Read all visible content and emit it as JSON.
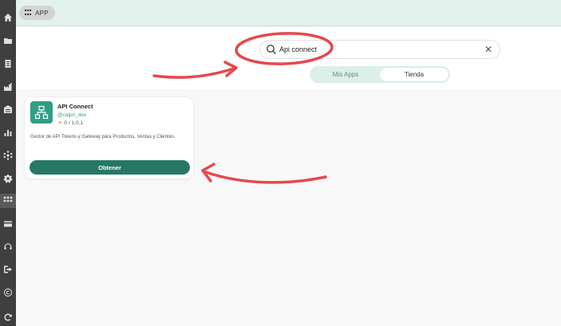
{
  "topbar": {
    "app_label": "APP"
  },
  "sidebar": {
    "items": [
      {
        "icon": "home-icon"
      },
      {
        "icon": "folder-icon"
      },
      {
        "icon": "document-icon"
      },
      {
        "icon": "factory-icon"
      },
      {
        "icon": "building-icon"
      },
      {
        "icon": "bar-chart-icon"
      },
      {
        "icon": "network-icon"
      },
      {
        "icon": "gear-icon"
      },
      {
        "icon": "apps-icon"
      },
      {
        "icon": "card-icon"
      },
      {
        "icon": "headset-icon"
      },
      {
        "icon": "logout-icon"
      },
      {
        "icon": "copyright-icon"
      },
      {
        "icon": "refresh-icon"
      }
    ]
  },
  "search": {
    "value": "Api connect",
    "clear_symbol": "✕"
  },
  "tabs": {
    "mis_apps": "Mis Apps",
    "tienda": "Tienda",
    "active": "Tienda"
  },
  "card": {
    "title": "API Connect",
    "author": "@calpri_dev",
    "rating": "0",
    "version": "/ 1.0.1",
    "description": "Gestor de API Tokens y Gateway para Productos, Ventas y Clientes.",
    "button_label": "Obtener"
  },
  "colors": {
    "accent": "#2f9e86",
    "button": "#267865",
    "sidebar": "#3f3f3f",
    "annotation": "#e5484d"
  }
}
